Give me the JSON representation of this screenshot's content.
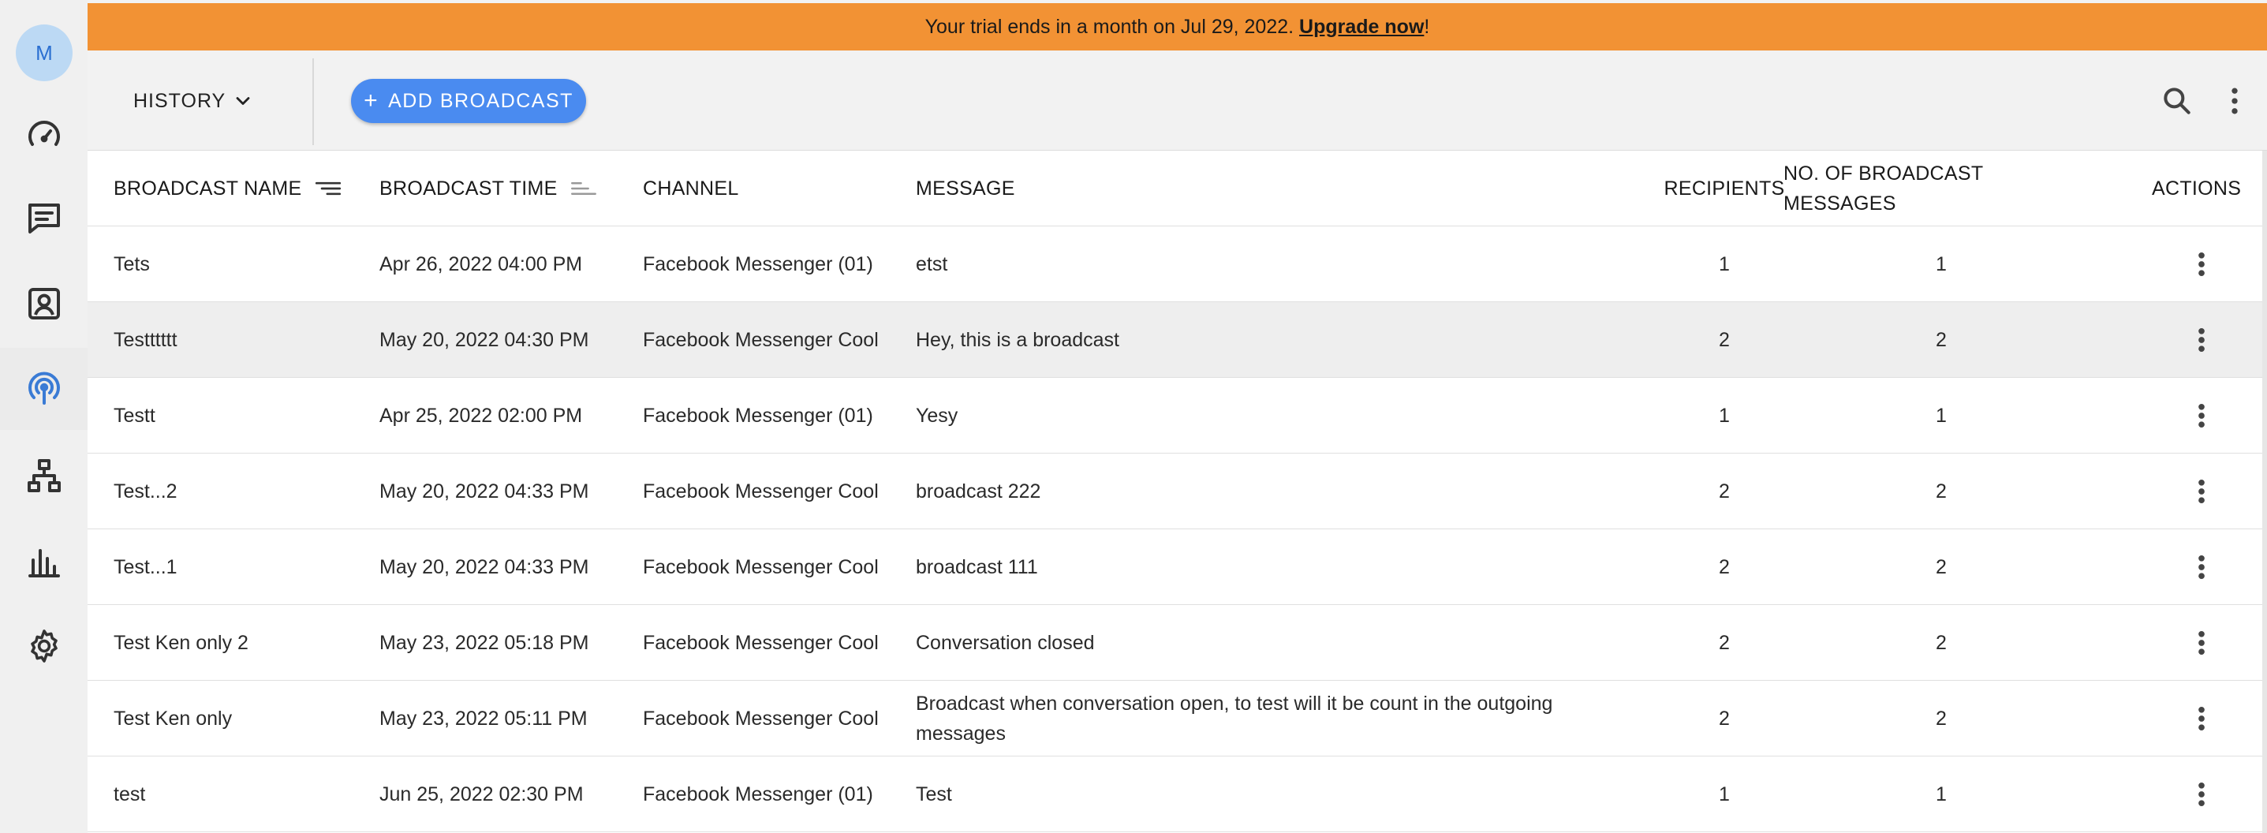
{
  "user": {
    "initial": "M"
  },
  "sidebar": {
    "items": [
      {
        "icon": "speedometer-icon",
        "active": false
      },
      {
        "icon": "chat-icon",
        "active": false
      },
      {
        "icon": "contact-icon",
        "active": false
      },
      {
        "icon": "broadcast-icon",
        "active": true
      },
      {
        "icon": "workflow-icon",
        "active": false
      },
      {
        "icon": "bar-chart-icon",
        "active": false
      },
      {
        "icon": "gear-icon",
        "active": false
      }
    ]
  },
  "banner": {
    "text": "Your trial ends in a month on Jul 29, 2022. ",
    "link": "Upgrade now",
    "suffix": "!"
  },
  "toolbar": {
    "history_label": "HISTORY",
    "add_label": "ADD BROADCAST"
  },
  "table": {
    "headers": {
      "name": "BROADCAST NAME",
      "time": "BROADCAST TIME",
      "channel": "CHANNEL",
      "message": "MESSAGE",
      "recipients": "RECIPIENTS",
      "count": "NO. OF BROADCAST MESSAGES",
      "actions": "ACTIONS"
    },
    "rows": [
      {
        "name": "Tets",
        "time": "Apr 26, 2022 04:00 PM",
        "channel": "Facebook Messenger (01)",
        "message": "etst",
        "recipients": "1",
        "count": "1"
      },
      {
        "name": "Testttttt",
        "time": "May 20, 2022 04:30 PM",
        "channel": "Facebook Messenger Cool",
        "message": "Hey, this is a broadcast",
        "recipients": "2",
        "count": "2"
      },
      {
        "name": "Testt",
        "time": "Apr 25, 2022 02:00 PM",
        "channel": "Facebook Messenger (01)",
        "message": "Yesy",
        "recipients": "1",
        "count": "1"
      },
      {
        "name": "Test...2",
        "time": "May 20, 2022 04:33 PM",
        "channel": "Facebook Messenger Cool",
        "message": "broadcast 222",
        "recipients": "2",
        "count": "2"
      },
      {
        "name": "Test...1",
        "time": "May 20, 2022 04:33 PM",
        "channel": "Facebook Messenger Cool",
        "message": "broadcast 111",
        "recipients": "2",
        "count": "2"
      },
      {
        "name": "Test Ken only 2",
        "time": "May 23, 2022 05:18 PM",
        "channel": "Facebook Messenger Cool",
        "message": "Conversation closed",
        "recipients": "2",
        "count": "2"
      },
      {
        "name": "Test Ken only",
        "time": "May 23, 2022 05:11 PM",
        "channel": "Facebook Messenger Cool",
        "message": "Broadcast when conversation open, to test will it be count in the outgoing messages",
        "recipients": "2",
        "count": "2"
      },
      {
        "name": "test",
        "time": "Jun 25, 2022 02:30 PM",
        "channel": "Facebook Messenger (01)",
        "message": "Test",
        "recipients": "1",
        "count": "1"
      }
    ]
  },
  "colors": {
    "banner": "#f29234",
    "accent": "#4a8bf0",
    "active_icon": "#3a7bd5",
    "avatar_bg": "#bcd9f4"
  }
}
